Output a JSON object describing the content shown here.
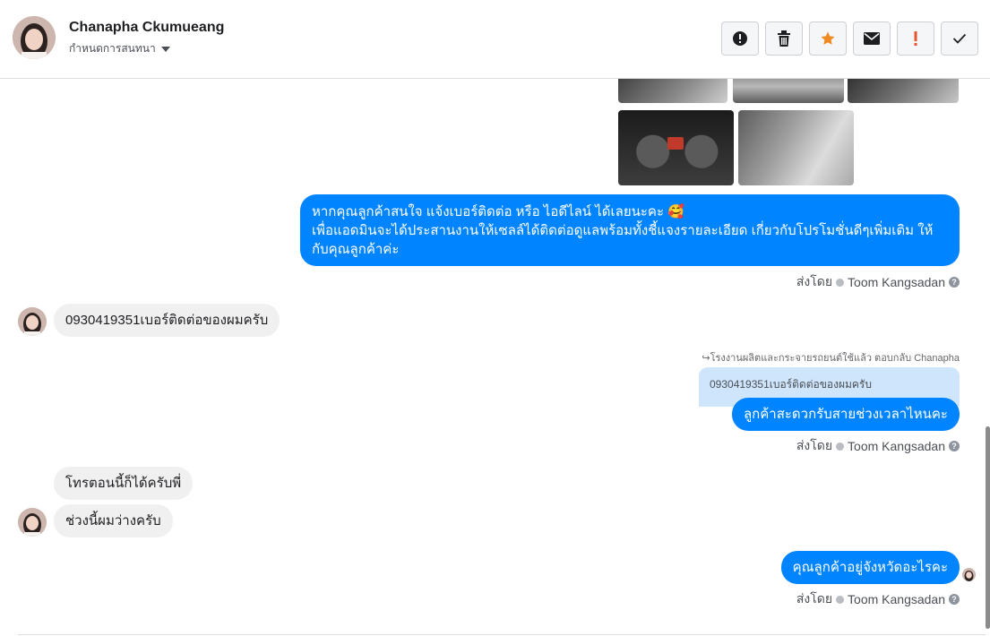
{
  "header": {
    "contact_name": "Chanapha Ckumueang",
    "assign_label": "กำหนดการสนทนา"
  },
  "toolbar": [
    {
      "name": "spam-button",
      "icon": "exclamation-circle-icon"
    },
    {
      "name": "delete-button",
      "icon": "trash-icon"
    },
    {
      "name": "star-button",
      "icon": "star-icon",
      "color": "#f08a24"
    },
    {
      "name": "mark-unread-button",
      "icon": "envelope-icon"
    },
    {
      "name": "follow-up-button",
      "icon": "exclamation-icon",
      "color": "#e4572e"
    },
    {
      "name": "done-button",
      "icon": "check-icon"
    }
  ],
  "messages": {
    "m1_line1": "หากคุณลูกค้าสนใจ แจ้งเบอร์ติดต่อ หรือ ไอดีไลน์ ได้เลยนะคะ 🥰",
    "m1_line2": "เพื่อแอดมินจะได้ประสานงานให้เซลล์ได้ติดต่อดูแลพร้อมทั้งชี้แจงรายละเอียด เกี่ยวกับโปรโมชั่นดีๆเพิ่มเติม ให้",
    "m1_line3": "กับคุณลูกค้าค่ะ",
    "m2": "0930419351เบอร์ติดต่อของผมครับ",
    "reply_note": "↪โรงงานผลิตและกระจายรถยนต์ใช้แล้ว ตอบกลับ Chanapha",
    "quoted": "0930419351เบอร์ติดต่อของผมครับ",
    "m3": "ลูกค้าสะดวกรับสายช่วงเวลาไหนคะ",
    "m4": "โทรตอนนี้ก็ได้ครับพี่",
    "m5": "ช่วงนี้ผมว่างครับ",
    "m6": "คุณลูกค้าอยู่จังหวัดอะไรคะ"
  },
  "sent_by": {
    "prefix": "ส่งโดย",
    "agent": "Toom Kangsadan"
  },
  "colors": {
    "outgoing": "#0084ff",
    "incoming": "#f1f0f0"
  }
}
